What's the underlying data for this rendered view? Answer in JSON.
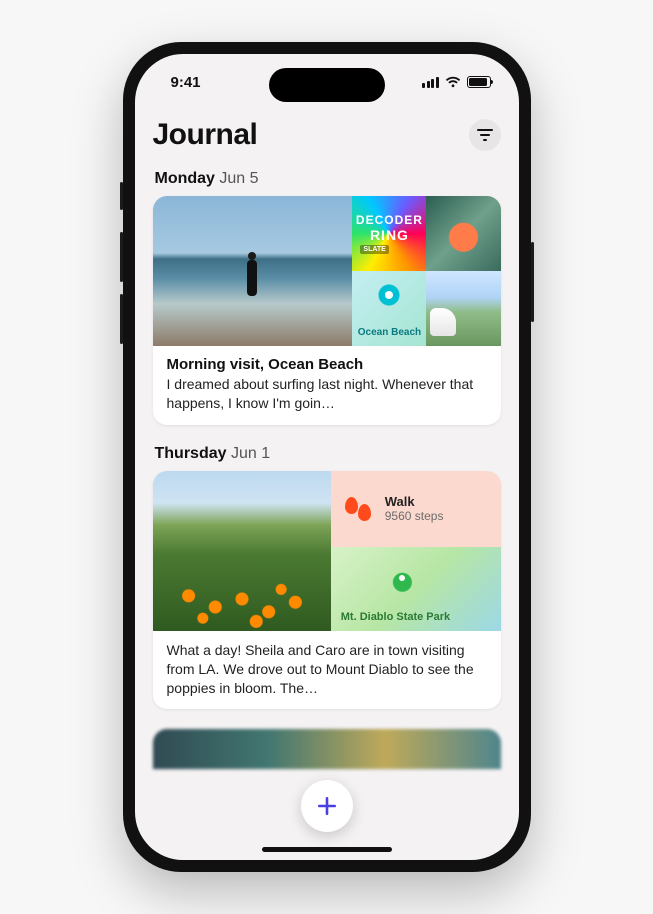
{
  "status": {
    "time": "9:41"
  },
  "header": {
    "title": "Journal"
  },
  "entries": [
    {
      "day_of_week": "Monday",
      "date": "Jun 5",
      "title": "Morning visit, Ocean Beach",
      "text": "I dreamed about surfing last night. Whenever that happens, I know I'm goin…",
      "podcast": {
        "line1": "DECODER",
        "line2": "RING",
        "publisher": "SLATE"
      },
      "map_label": "Ocean Beach"
    },
    {
      "day_of_week": "Thursday",
      "date": "Jun 1",
      "text": "What a day! Sheila and Caro are in town visiting from LA. We drove out to Mount Diablo to see the poppies in bloom. The…",
      "activity": {
        "label": "Walk",
        "detail": "9560 steps"
      },
      "map_label": "Mt. Diablo State Park"
    }
  ]
}
